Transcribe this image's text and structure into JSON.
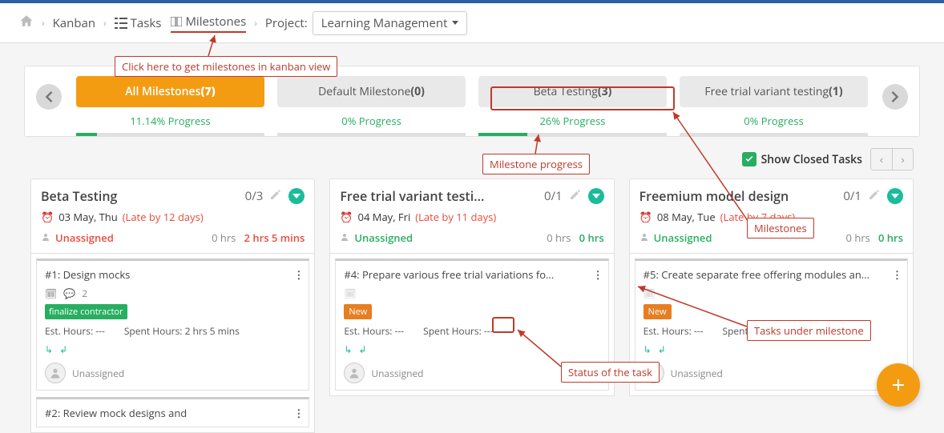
{
  "breadcrumb": {
    "kanban": "Kanban",
    "tasks": "Tasks",
    "milestones": "Milestones",
    "project_label": "Project:",
    "project_value": "Learning Management"
  },
  "milestone_tabs": [
    {
      "label": "All Milestones",
      "count": "(7)",
      "progress_text": "11.14% Progress",
      "progress_pct": 11.14,
      "active": true
    },
    {
      "label": "Default Milestone",
      "count": "(0)",
      "progress_text": "0% Progress",
      "progress_pct": 0,
      "active": false
    },
    {
      "label": "Beta Testing",
      "count": "(3)",
      "progress_text": "26% Progress",
      "progress_pct": 26,
      "active": false
    },
    {
      "label": "Free trial variant testing",
      "count": "(1)",
      "progress_text": "0% Progress",
      "progress_pct": 0,
      "active": false
    }
  ],
  "toolbar": {
    "show_closed": "Show Closed Tasks"
  },
  "columns": [
    {
      "title": "Beta Testing",
      "count": "0/3",
      "date": "03 May, Thu",
      "late": "(Late by 12 days)",
      "assigned": "Unassigned",
      "assigned_style": "red",
      "hrs1": "0 hrs",
      "hrs2": "2 hrs 5 mins",
      "hrs2_style": "red",
      "cards": [
        {
          "title": "#1: Design mocks",
          "comments": "2",
          "tag": "finalize contractor",
          "tag_style": "finalize",
          "est": "Est. Hours: ---",
          "spent": "Spent Hours: 2 hrs 5 mins",
          "assignee": "Unassigned"
        },
        {
          "title": "#2: Review mock designs and"
        }
      ]
    },
    {
      "title": "Free trial variant testi...",
      "count": "0/1",
      "date": "04 May, Fri",
      "late": "(Late by 11 days)",
      "assigned": "Unassigned",
      "assigned_style": "green",
      "hrs1": "0 hrs",
      "hrs2": "0 hrs",
      "hrs2_style": "green",
      "cards": [
        {
          "title": "#4: Prepare various free trial variations fo...",
          "tag": "New",
          "tag_style": "new",
          "est": "Est. Hours: ---",
          "spent": "Spent Hours: ---",
          "assignee": "Unassigned"
        }
      ]
    },
    {
      "title": "Freemium model design",
      "count": "0/1",
      "date": "08 May, Tue",
      "late": "(Late by 7 days)",
      "assigned": "Unassigned",
      "assigned_style": "green",
      "hrs1": "0 hrs",
      "hrs2": "0 hrs",
      "hrs2_style": "green",
      "cards": [
        {
          "title": "#5: Create separate free offering modules an...",
          "tag": "New",
          "tag_style": "new",
          "est": "Est. Hours: ---",
          "spent": "Spent Hours: ---",
          "assignee": "Unassigned"
        }
      ]
    }
  ],
  "annotations": {
    "milestones_crumb": "Click here to get milestones in kanban view",
    "progress": "Milestone progress",
    "milestones": "Milestones",
    "tasks_under": "Tasks under milestone",
    "status": "Status of the task"
  }
}
